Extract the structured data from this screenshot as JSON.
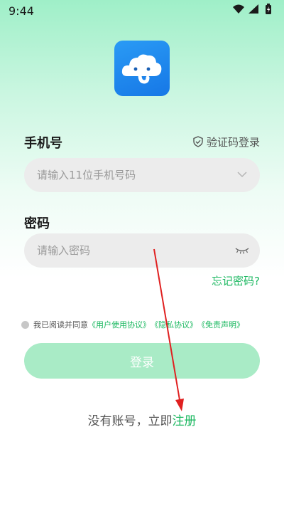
{
  "status_bar": {
    "time": "9:44"
  },
  "form": {
    "phone_label": "手机号",
    "phone_placeholder": "请输入11位手机号码",
    "sms_login": "验证码登录",
    "password_label": "密码",
    "password_placeholder": "请输入密码",
    "forgot_password": "忘记密码?"
  },
  "agreement": {
    "prefix": "我已阅读并同意",
    "user_agreement": "《用户使用协议》",
    "privacy_policy": "《隐私协议》",
    "disclaimer": "《免责声明》"
  },
  "login_button": "登录",
  "register": {
    "prefix": "没有账号，立即",
    "link": "注册"
  },
  "colors": {
    "accent": "#1bb860",
    "button": "#a9ebc6",
    "logo": "#1677e6",
    "annotation_arrow": "#e02020"
  }
}
